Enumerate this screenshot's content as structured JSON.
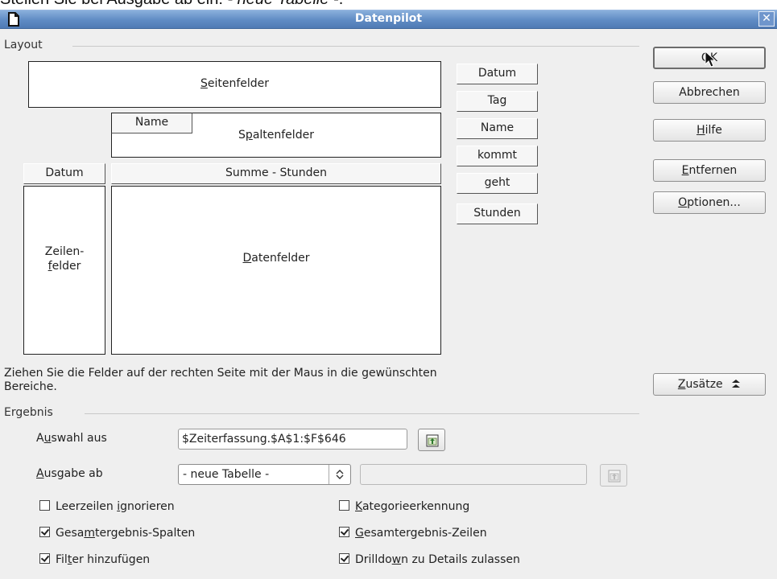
{
  "caption": {
    "prefix": "Stellen Sie bei Ausgabe ab ein: ",
    "emphasis": "- neue Tabelle -",
    "suffix": "."
  },
  "window": {
    "title": "Datenpilot",
    "close_icon": "close-icon",
    "app_icon": "document-icon"
  },
  "layout": {
    "section_title": "Layout",
    "page_fields": {
      "pre": "",
      "key": "S",
      "post": "eitenfelder"
    },
    "column_fields": {
      "pre": "S",
      "key": "p",
      "post": "altenfelder"
    },
    "column_field_button": "Name",
    "row_field_button": "Datum",
    "data_field_button": "Summe - Stunden",
    "row_fields": {
      "line1": "Zeilen-",
      "key": "f",
      "post": "elder"
    },
    "data_fields": {
      "pre": "",
      "key": "D",
      "post": "atenfelder"
    },
    "available_fields": [
      "Datum",
      "Tag",
      "Name",
      "kommt",
      "geht",
      "Stunden"
    ],
    "hint": "Ziehen Sie die Felder auf der rechten Seite mit der Maus in die gewünschten Bereiche."
  },
  "buttons": {
    "ok": "OK",
    "cancel": "Abbrechen",
    "help": {
      "pre": "",
      "key": "H",
      "post": "ilfe"
    },
    "remove": {
      "pre": "",
      "key": "E",
      "post": "ntfernen"
    },
    "options": {
      "pre": "",
      "key": "O",
      "post": "ptionen..."
    },
    "more": {
      "pre": "",
      "key": "Z",
      "post": "usätze",
      "icon": "double-chevron-up-icon"
    }
  },
  "result": {
    "section_title": "Ergebnis",
    "selection_label": {
      "pre": "A",
      "key": "u",
      "post": "swahl aus"
    },
    "selection_value": "$Zeiterfassung.$A$1:$F$646",
    "output_label": {
      "pre": "",
      "key": "A",
      "post": "usgabe ab"
    },
    "output_select": "- neue Tabelle -",
    "output_value": ""
  },
  "options": {
    "ignore_empty": {
      "pre": "Leerzeilen ",
      "key": "i",
      "post": "gnorieren",
      "checked": false
    },
    "identify_categories": {
      "pre": "",
      "key": "K",
      "post": "ategorieerkennung",
      "checked": false
    },
    "total_columns": {
      "pre": "Gesa",
      "key": "m",
      "post": "tergebnis-Spalten",
      "checked": true
    },
    "total_rows": {
      "pre": "",
      "key": "G",
      "post": "esamtergebnis-Zeilen",
      "checked": true
    },
    "add_filter": {
      "pre": "Fil",
      "key": "t",
      "post": "er hinzufügen",
      "checked": true
    },
    "drilldown": {
      "pre": "Drilldo",
      "key": "w",
      "post": "n zu Details zulassen",
      "checked": true
    }
  }
}
